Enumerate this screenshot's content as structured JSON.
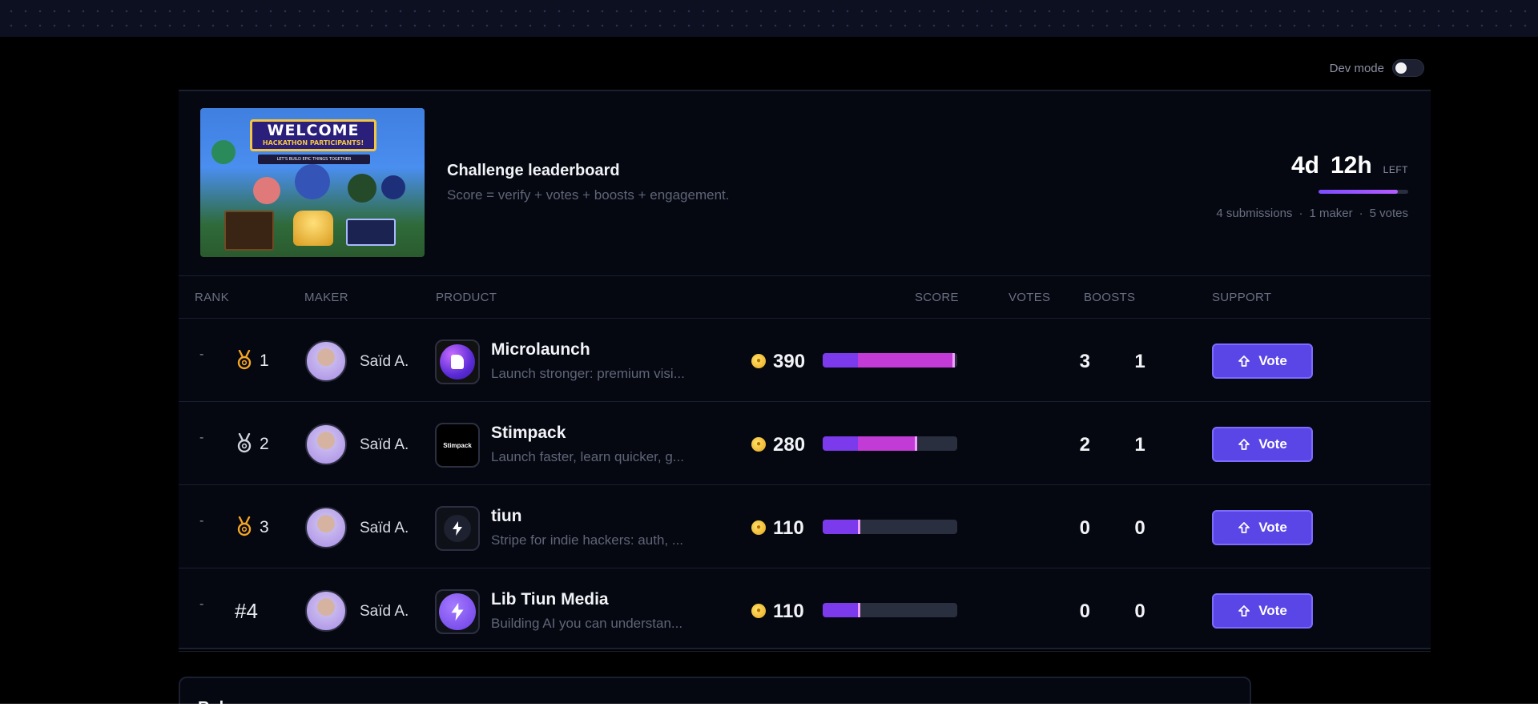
{
  "dev_mode": {
    "label": "Dev mode",
    "enabled": false
  },
  "header": {
    "banner": {
      "title": "WELCOME",
      "subtitle": "HACKATHON PARTICIPANTS!",
      "ribbon": "LET'S BUILD EPIC THINGS TOGETHER"
    },
    "title": "Challenge leaderboard",
    "subtitle": "Score = verify + votes + boosts + engagement.",
    "timer": {
      "days": "4d",
      "hours": "12h",
      "left_label": "LEFT",
      "progress_percent": 88
    },
    "stats": {
      "submissions": "4 submissions",
      "makers": "1 maker",
      "votes": "5 votes",
      "separator": "·"
    }
  },
  "columns": {
    "rank": "RANK",
    "maker": "MAKER",
    "product": "PRODUCT",
    "score": "SCORE",
    "votes": "VOTES",
    "boosts": "BOOSTS",
    "support": "SUPPORT"
  },
  "rows": [
    {
      "change": "-",
      "rank": "1",
      "medal": "gold-medal-icon",
      "maker": "Saïd A.",
      "product": "Microlaunch",
      "description": "Launch stronger: premium visi...",
      "logo": "microlaunch-logo",
      "score": "390",
      "bar_primary_fraction": 0.26,
      "bar_secondary_fraction": 0.72,
      "votes": "3",
      "boosts": "1",
      "vote_label": "Vote"
    },
    {
      "change": "-",
      "rank": "2",
      "medal": "silver-medal-icon",
      "maker": "Saïd A.",
      "product": "Stimpack",
      "description": "Launch faster, learn quicker, g...",
      "logo": "stimpack-logo",
      "logo_text": "Stimpack",
      "score": "280",
      "bar_primary_fraction": 0.26,
      "bar_secondary_fraction": 0.44,
      "votes": "2",
      "boosts": "1",
      "vote_label": "Vote"
    },
    {
      "change": "-",
      "rank": "3",
      "medal": "bronze-medal-icon",
      "maker": "Saïd A.",
      "product": "tiun",
      "description": "Stripe for indie hackers: auth, ...",
      "logo": "lightning-icon",
      "score": "110",
      "bar_primary_fraction": 0.26,
      "bar_secondary_fraction": 0.0,
      "votes": "0",
      "boosts": "0",
      "vote_label": "Vote"
    },
    {
      "change": "-",
      "rank": "#4",
      "medal": "",
      "maker": "Saïd A.",
      "product": "Lib Tiun Media",
      "description": "Building AI you can understan...",
      "logo": "lightning-circle-icon",
      "score": "110",
      "bar_primary_fraction": 0.26,
      "bar_secondary_fraction": 0.0,
      "votes": "0",
      "boosts": "0",
      "vote_label": "Vote"
    }
  ],
  "next_section": {
    "title": "Rules recap"
  },
  "colors": {
    "accent": "#5a45e6",
    "bar_primary": "#7c3aed",
    "bar_secondary": "#c23bd6",
    "gold": "#f5a524",
    "silver": "#cfd3dc"
  }
}
